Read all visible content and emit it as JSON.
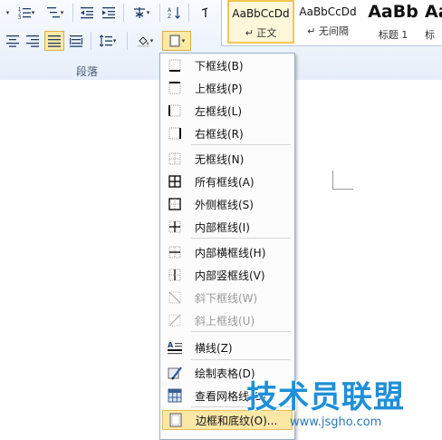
{
  "ribbon": {
    "group_label": "段落",
    "styles": [
      {
        "preview": "AaBbCcDd",
        "name": "↵ 正文",
        "active": true
      },
      {
        "preview": "AaBbCcDd",
        "name": "↵ 无间隔",
        "active": false
      },
      {
        "preview": "AaBb",
        "name": "标题 1",
        "active": false,
        "big": true
      },
      {
        "preview": "Aa",
        "name": "标",
        "active": false,
        "big": true
      }
    ]
  },
  "menu": {
    "items": [
      {
        "label": "下框线(B)",
        "icon": "border-bottom-icon",
        "enabled": true
      },
      {
        "label": "上框线(P)",
        "icon": "border-top-icon",
        "enabled": true
      },
      {
        "label": "左框线(L)",
        "icon": "border-left-icon",
        "enabled": true
      },
      {
        "label": "右框线(R)",
        "icon": "border-right-icon",
        "enabled": true
      },
      {
        "label": "无框线(N)",
        "icon": "no-border-icon",
        "enabled": true
      },
      {
        "label": "所有框线(A)",
        "icon": "all-borders-icon",
        "enabled": true
      },
      {
        "label": "外侧框线(S)",
        "icon": "outside-borders-icon",
        "enabled": true
      },
      {
        "label": "内部框线(I)",
        "icon": "inside-borders-icon",
        "enabled": true
      },
      {
        "label": "内部横框线(H)",
        "icon": "inside-horizontal-border-icon",
        "enabled": true
      },
      {
        "label": "内部竖框线(V)",
        "icon": "inside-vertical-border-icon",
        "enabled": true
      },
      {
        "label": "斜下框线(W)",
        "icon": "diagonal-down-border-icon",
        "enabled": false
      },
      {
        "label": "斜上框线(U)",
        "icon": "diagonal-up-border-icon",
        "enabled": false
      },
      {
        "label": "横线(Z)",
        "icon": "horizontal-line-icon",
        "enabled": true
      },
      {
        "label": "绘制表格(D)",
        "icon": "draw-table-icon",
        "enabled": true
      },
      {
        "label": "查看网格线(G)",
        "icon": "view-gridlines-icon",
        "enabled": true
      },
      {
        "label": "边框和底纹(O)...",
        "icon": "borders-shading-icon",
        "enabled": true,
        "highlighted": true
      }
    ]
  },
  "watermark": {
    "text": "技术员联盟",
    "url": "www.jsgho.com"
  }
}
